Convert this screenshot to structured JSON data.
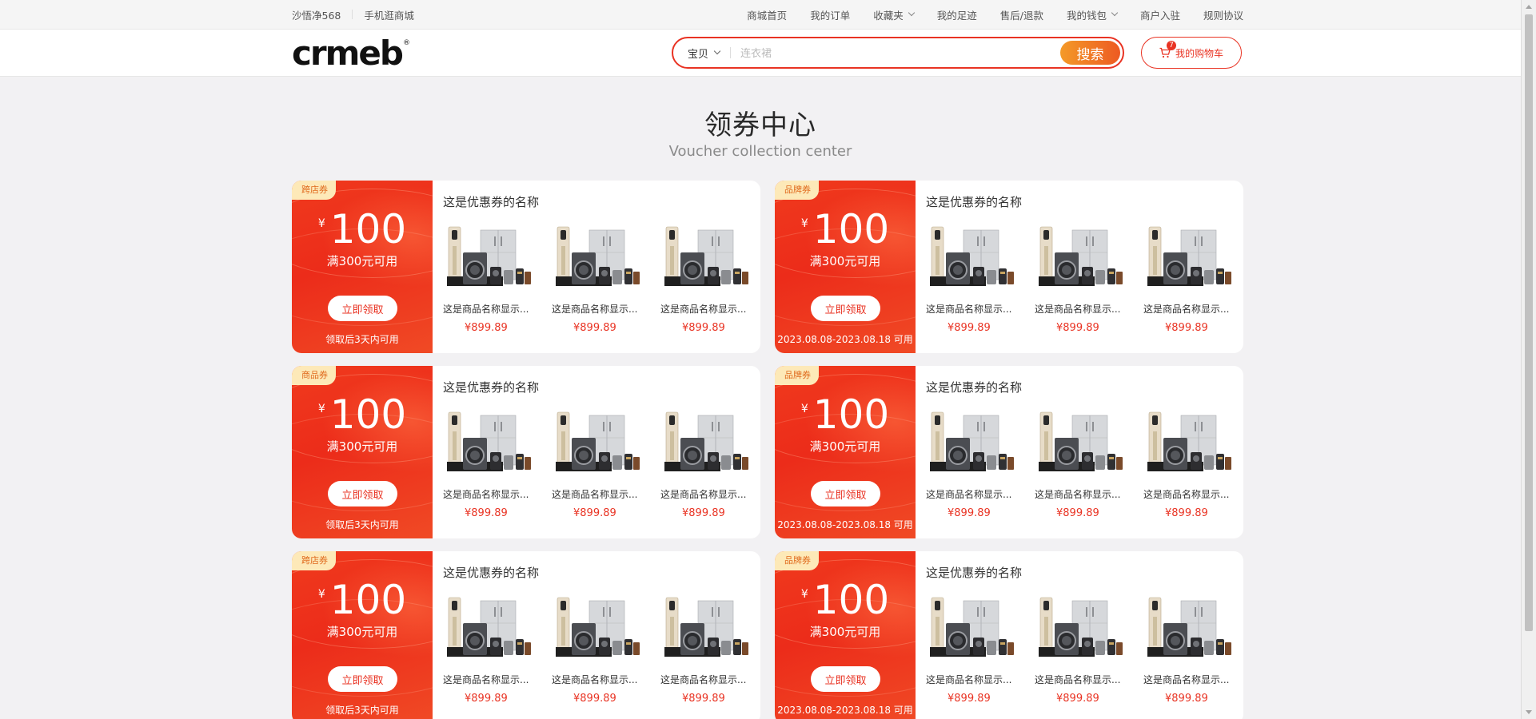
{
  "topbar": {
    "username": "沙悟净568",
    "mall_link": "手机逛商城",
    "links": [
      {
        "label": "商城首页",
        "dropdown": false
      },
      {
        "label": "我的订单",
        "dropdown": false
      },
      {
        "label": "收藏夹",
        "dropdown": true
      },
      {
        "label": "我的足迹",
        "dropdown": false
      },
      {
        "label": "售后/退款",
        "dropdown": false
      },
      {
        "label": "我的钱包",
        "dropdown": true
      },
      {
        "label": "商户入驻",
        "dropdown": false
      },
      {
        "label": "规则协议",
        "dropdown": false
      }
    ]
  },
  "header": {
    "logo_text": "crmeb",
    "logo_reg": "®",
    "search_type": "宝贝",
    "search_placeholder": "连衣裙",
    "search_button": "搜索",
    "cart_label": "我的购物车",
    "cart_count": "7"
  },
  "page": {
    "title": "领券中心",
    "subtitle": "Voucher collection center"
  },
  "colors": {
    "accent": "#e93323",
    "voucher_bg": "#ef2f1b",
    "tag_bg": "#fde9b8",
    "tag_text": "#e06a1d",
    "search_button": "#ee6a23"
  },
  "coupons": [
    {
      "tag": "跨店券",
      "currency": "¥",
      "amount": "100",
      "condition": "满300元可用",
      "button": "立即领取",
      "validity": "领取后3天内可用",
      "name": "这是优惠券的名称",
      "products": [
        {
          "name": "这是商品名称显示...",
          "price": "¥899.89"
        },
        {
          "name": "这是商品名称显示...",
          "price": "¥899.89"
        },
        {
          "name": "这是商品名称显示...",
          "price": "¥899.89"
        }
      ]
    },
    {
      "tag": "品牌券",
      "currency": "¥",
      "amount": "100",
      "condition": "满300元可用",
      "button": "立即领取",
      "validity": "2023.08.08-2023.08.18 可用",
      "name": "这是优惠券的名称",
      "products": [
        {
          "name": "这是商品名称显示...",
          "price": "¥899.89"
        },
        {
          "name": "这是商品名称显示...",
          "price": "¥899.89"
        },
        {
          "name": "这是商品名称显示...",
          "price": "¥899.89"
        }
      ]
    },
    {
      "tag": "商品券",
      "currency": "¥",
      "amount": "100",
      "condition": "满300元可用",
      "button": "立即领取",
      "validity": "领取后3天内可用",
      "name": "这是优惠券的名称",
      "products": [
        {
          "name": "这是商品名称显示...",
          "price": "¥899.89"
        },
        {
          "name": "这是商品名称显示...",
          "price": "¥899.89"
        },
        {
          "name": "这是商品名称显示...",
          "price": "¥899.89"
        }
      ]
    },
    {
      "tag": "品牌券",
      "currency": "¥",
      "amount": "100",
      "condition": "满300元可用",
      "button": "立即领取",
      "validity": "2023.08.08-2023.08.18 可用",
      "name": "这是优惠券的名称",
      "products": [
        {
          "name": "这是商品名称显示...",
          "price": "¥899.89"
        },
        {
          "name": "这是商品名称显示...",
          "price": "¥899.89"
        },
        {
          "name": "这是商品名称显示...",
          "price": "¥899.89"
        }
      ]
    },
    {
      "tag": "跨店券",
      "currency": "¥",
      "amount": "100",
      "condition": "满300元可用",
      "button": "立即领取",
      "validity": "领取后3天内可用",
      "name": "这是优惠券的名称",
      "products": [
        {
          "name": "这是商品名称显示...",
          "price": "¥899.89"
        },
        {
          "name": "这是商品名称显示...",
          "price": "¥899.89"
        },
        {
          "name": "这是商品名称显示...",
          "price": "¥899.89"
        }
      ]
    },
    {
      "tag": "品牌券",
      "currency": "¥",
      "amount": "100",
      "condition": "满300元可用",
      "button": "立即领取",
      "validity": "2023.08.08-2023.08.18 可用",
      "name": "这是优惠券的名称",
      "products": [
        {
          "name": "这是商品名称显示...",
          "price": "¥899.89"
        },
        {
          "name": "这是商品名称显示...",
          "price": "¥899.89"
        },
        {
          "name": "这是商品名称显示...",
          "price": "¥899.89"
        }
      ]
    }
  ]
}
